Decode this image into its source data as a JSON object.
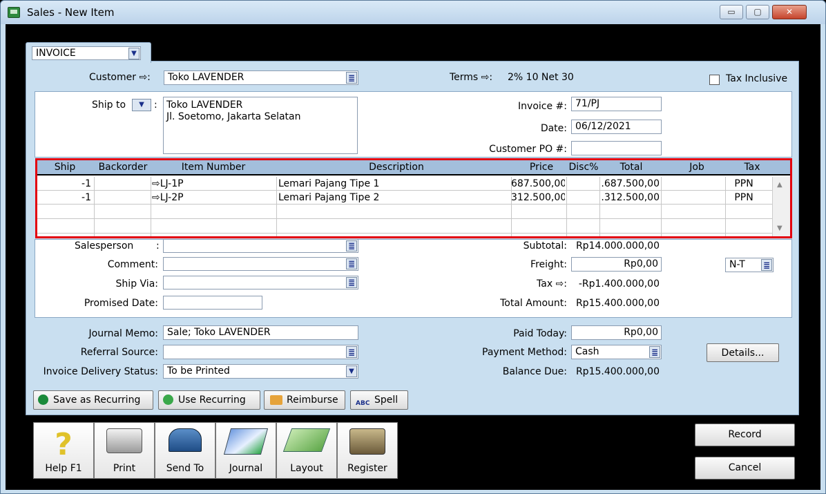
{
  "window": {
    "title": "Sales - New Item",
    "min": "▭",
    "max": "▢",
    "close": "✕"
  },
  "layout_dropdown": {
    "value": "INVOICE"
  },
  "header": {
    "customer_label": "Customer ⇨:",
    "customer_value": "Toko LAVENDER",
    "terms_label": "Terms ⇨:",
    "terms_value": "2% 10 Net 30",
    "tax_inclusive_label": "Tax Inclusive"
  },
  "ship": {
    "label": "Ship to",
    "colon": ":",
    "address_line1": "Toko LAVENDER",
    "address_line2": "Jl. Soetomo, Jakarta Selatan"
  },
  "invoice": {
    "number_label": "Invoice #:",
    "number": "71/PJ",
    "date_label": "Date:",
    "date": "06/12/2021",
    "po_label": "Customer PO #:",
    "po": ""
  },
  "grid": {
    "headers": [
      "Ship",
      "Backorder",
      "Item Number",
      "Description",
      "Price",
      "Disc%",
      "Total",
      "Job",
      "Tax"
    ],
    "rows": [
      {
        "ship": "-1",
        "backorder": "",
        "item": "⇨LJ-1P",
        "description": "Lemari Pajang Tipe 1",
        "price": "687.500,00",
        "disc": "",
        "total": ".687.500,00",
        "job": "",
        "tax": "PPN"
      },
      {
        "ship": "-1",
        "backorder": "",
        "item": "⇨LJ-2P",
        "description": "Lemari Pajang Tipe 2",
        "price": "312.500,00",
        "disc": "",
        "total": ".312.500,00",
        "job": "",
        "tax": "PPN"
      }
    ]
  },
  "details": {
    "salesperson_label": "Salesperson",
    "salesperson_colon": ":",
    "comment_label": "Comment:",
    "ship_via_label": "Ship Via:",
    "promised_label": "Promised Date:",
    "subtotal_label": "Subtotal:",
    "subtotal": "Rp14.000.000,00",
    "freight_label": "Freight:",
    "freight": "Rp0,00",
    "freight_tax": "N-T",
    "tax_label": "Tax ⇨:",
    "tax": "-Rp1.400.000,00",
    "total_label": "Total Amount:",
    "total": "Rp15.400.000,00"
  },
  "footer": {
    "memo_label": "Journal Memo:",
    "memo": "Sale; Toko LAVENDER",
    "referral_label": "Referral Source:",
    "delivery_label": "Invoice Delivery Status:",
    "delivery": "To be Printed",
    "paid_label": "Paid Today:",
    "paid": "Rp0,00",
    "method_label": "Payment Method:",
    "method": "Cash",
    "balance_label": "Balance Due:",
    "balance": "Rp15.400.000,00",
    "details_btn": "Details..."
  },
  "actions": {
    "save_recurring": "Save as Recurring",
    "use_recurring": "Use Recurring",
    "reimburse": "Reimburse",
    "spell": "Spell"
  },
  "toolbar": {
    "help": "Help F1",
    "print": "Print",
    "send": "Send To",
    "journal": "Journal",
    "layout": "Layout",
    "register": "Register"
  },
  "buttons": {
    "record": "Record",
    "cancel": "Cancel"
  },
  "icons": {
    "colors": {
      "grid_header": "#a3bfdc",
      "highlight": "#e3000f",
      "form_bg": "#c9dff0"
    }
  }
}
